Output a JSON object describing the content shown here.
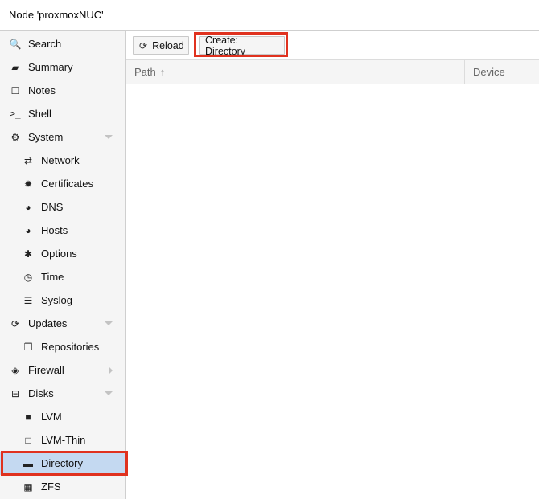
{
  "title": "Node 'proxmoxNUC'",
  "sidebar": {
    "items": [
      {
        "label": "Search",
        "icon": "search-icon",
        "glyph": "🔍",
        "level": 0
      },
      {
        "label": "Summary",
        "icon": "book-icon",
        "glyph": "▰",
        "level": 0
      },
      {
        "label": "Notes",
        "icon": "note-icon",
        "glyph": "☐",
        "level": 0
      },
      {
        "label": "Shell",
        "icon": "terminal-icon",
        "glyph": ">_",
        "level": 0
      },
      {
        "label": "System",
        "icon": "cogs-icon",
        "glyph": "⚙",
        "level": 0,
        "expanded": true
      },
      {
        "label": "Network",
        "icon": "exchange-icon",
        "glyph": "⇄",
        "level": 1
      },
      {
        "label": "Certificates",
        "icon": "certificate-icon",
        "glyph": "✹",
        "level": 1
      },
      {
        "label": "DNS",
        "icon": "globe-icon",
        "glyph": "◕",
        "level": 1
      },
      {
        "label": "Hosts",
        "icon": "globe-icon",
        "glyph": "◕",
        "level": 1
      },
      {
        "label": "Options",
        "icon": "gear-icon",
        "glyph": "✱",
        "level": 1
      },
      {
        "label": "Time",
        "icon": "clock-icon",
        "glyph": "◷",
        "level": 1
      },
      {
        "label": "Syslog",
        "icon": "list-icon",
        "glyph": "☰",
        "level": 1
      },
      {
        "label": "Updates",
        "icon": "refresh-icon",
        "glyph": "⟳",
        "level": 0,
        "expanded": true
      },
      {
        "label": "Repositories",
        "icon": "files-icon",
        "glyph": "❐",
        "level": 1
      },
      {
        "label": "Firewall",
        "icon": "shield-icon",
        "glyph": "◈",
        "level": 0,
        "expanded": false
      },
      {
        "label": "Disks",
        "icon": "hdd-icon",
        "glyph": "⊟",
        "level": 0,
        "expanded": true
      },
      {
        "label": "LVM",
        "icon": "square-icon",
        "glyph": "■",
        "level": 1
      },
      {
        "label": "LVM-Thin",
        "icon": "square-outline-icon",
        "glyph": "□",
        "level": 1
      },
      {
        "label": "Directory",
        "icon": "folder-icon",
        "glyph": "▬",
        "level": 1,
        "selected": true
      },
      {
        "label": "ZFS",
        "icon": "grid-icon",
        "glyph": "▦",
        "level": 1
      }
    ]
  },
  "toolbar": {
    "reload_label": "Reload",
    "create_label": "Create: Directory"
  },
  "grid": {
    "columns": [
      "Path",
      "Device"
    ],
    "sort_indicator": "↑"
  },
  "colors": {
    "highlight": "#e0321f",
    "selected": "#c4d9f1"
  }
}
